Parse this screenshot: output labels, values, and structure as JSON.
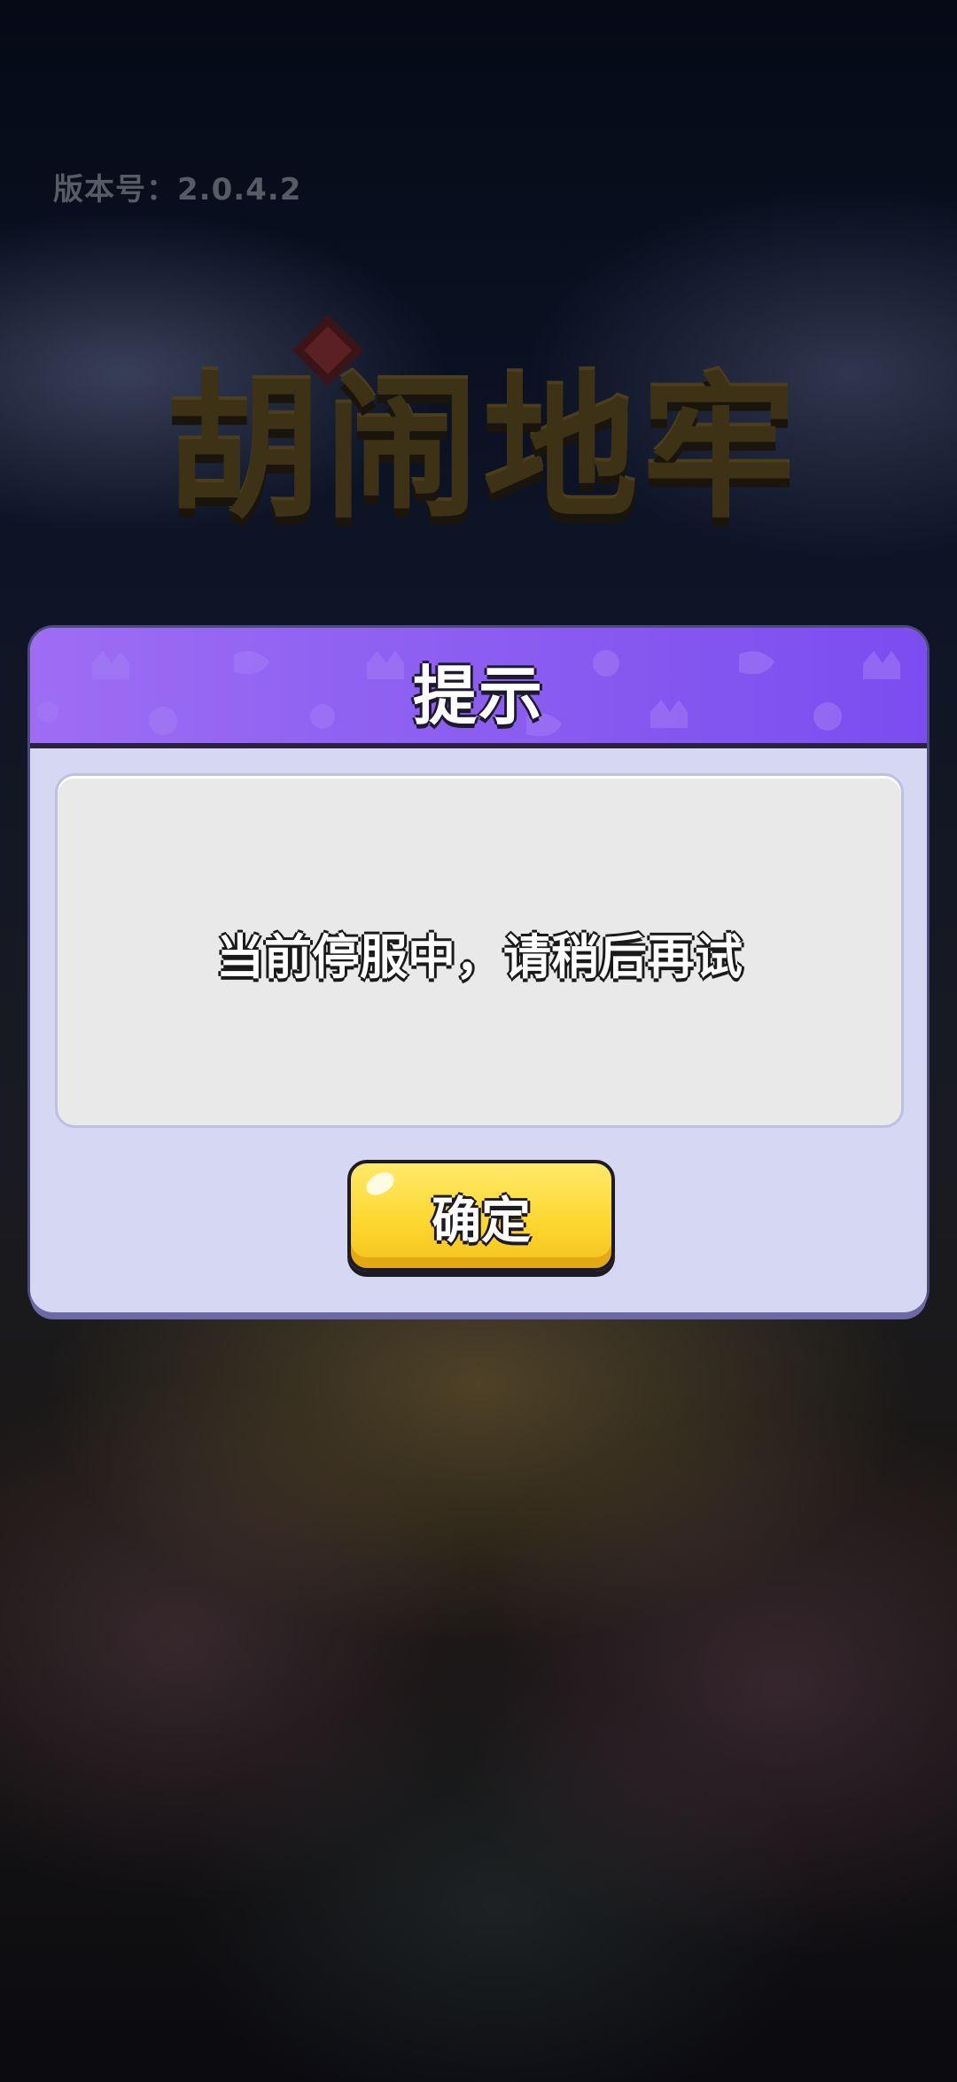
{
  "version": {
    "label": "版本号：2.0.4.2"
  },
  "logo": {
    "title": "胡闹地牢"
  },
  "dialog": {
    "title": "提示",
    "message": "当前停服中，请稍后再试",
    "confirm_label": "确定"
  },
  "colors": {
    "header_purple": "#8a5cf0",
    "dialog_body": "#d6d7f2",
    "button_yellow": "#fdd831"
  }
}
